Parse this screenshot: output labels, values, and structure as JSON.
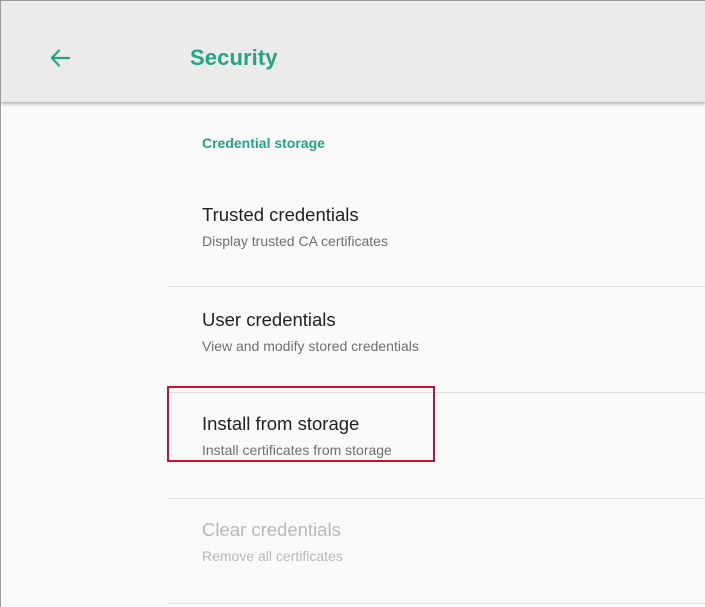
{
  "appbar": {
    "title": "Security",
    "back_icon": "arrow-left-icon",
    "accent_color": "#21a585"
  },
  "section": {
    "header": "Credential storage",
    "items": [
      {
        "title": "Trusted credentials",
        "summary": "Display trusted CA certificates",
        "enabled": true
      },
      {
        "title": "User credentials",
        "summary": "View and modify stored credentials",
        "enabled": true
      },
      {
        "title": "Install from storage",
        "summary": "Install certificates from storage",
        "enabled": true
      },
      {
        "title": "Clear credentials",
        "summary": "Remove all certificates",
        "enabled": false
      }
    ]
  },
  "annotation": {
    "highlight_color": "#c8102e"
  }
}
